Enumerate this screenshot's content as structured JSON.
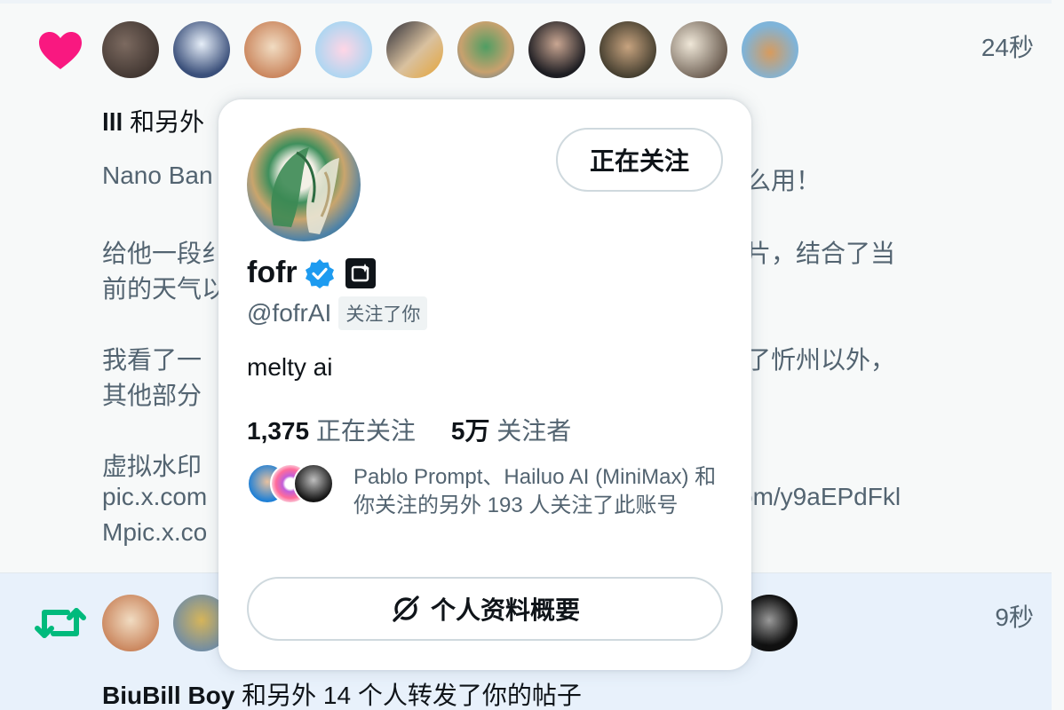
{
  "colors": {
    "like": "#f91880",
    "retweet": "#00ba7c",
    "verified": "#1d9bf0",
    "text_primary": "#0f1419",
    "text_secondary": "#536471"
  },
  "like_notification": {
    "time": "24秒",
    "summary_name": "lll",
    "summary_rest": " 和另外",
    "tweet_lines": [
      "Nano Ban",
      "么用！",
      "给他一段纟",
      "片，结合了当",
      "前的天气以",
      "我看了一",
      "了忻州以外，",
      "其他部分",
      "虚拟水印",
      "pic.x.com",
      "om/y9aEPdFkl",
      "Mpic.x.co"
    ],
    "avatars": [
      "user-avatar-1",
      "user-avatar-2",
      "user-avatar-3",
      "user-avatar-4",
      "user-avatar-5",
      "user-avatar-6",
      "user-avatar-7",
      "user-avatar-8",
      "user-avatar-9",
      "user-avatar-10"
    ]
  },
  "retweet_notification": {
    "time": "9秒",
    "summary_name": "BiuBill Boy",
    "summary_rest": " 和另外 14 个人转发了你的帖子"
  },
  "hover_card": {
    "follow_button": "正在关注",
    "name": "fofr",
    "handle": "@fofrAI",
    "follows_you": "关注了你",
    "bio": "melty ai",
    "following_count": "1,375",
    "following_label": "正在关注",
    "followers_count": "5万",
    "followers_label": "关注者",
    "mutuals_text": "Pablo Prompt、Hailuo AI (MiniMax) 和你关注的另外 193 人关注了此账号",
    "profile_summary_button": "个人资料概要"
  }
}
